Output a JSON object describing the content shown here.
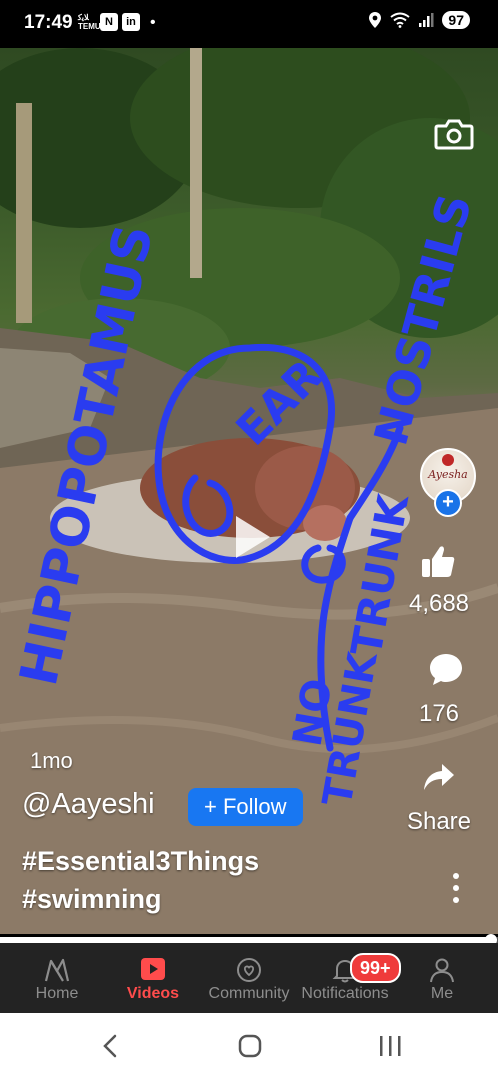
{
  "status_bar": {
    "time": "17:49",
    "temu_line1": "ﻼﻳﻛ",
    "temu_line2": "TEMU",
    "battery": "97",
    "icons": [
      "temu-icon",
      "n-app-icon",
      "linkedin-icon",
      "notification-dot",
      "location-icon",
      "wifi-icon",
      "signal-icon",
      "battery-icon"
    ]
  },
  "video": {
    "overlay_text": {
      "left_word": "HIPPOPOTAMUS",
      "center_word": "EAR",
      "right_word": "NOSTRILS",
      "bottom_word_1": "TRUNK",
      "bottom_word_2": "NO",
      "bottom_word_3": "TRUNK"
    },
    "paused": true
  },
  "author": {
    "avatar_text": "Ayesha",
    "handle": "@Aayeshi",
    "follow_label": "+ Follow"
  },
  "post": {
    "age": "1mo",
    "hashtags": [
      "#Essential3Things",
      "#swimning"
    ]
  },
  "actions": {
    "likes": "4,688",
    "comments": "176",
    "share_label": "Share"
  },
  "playback": {
    "progress_fraction": 0.985
  },
  "tabs": [
    {
      "label": "Home",
      "icon": "home-icon",
      "active": false
    },
    {
      "label": "Videos",
      "icon": "video-icon",
      "active": true
    },
    {
      "label": "Community",
      "icon": "community-icon",
      "active": false
    },
    {
      "label": "Notifications",
      "icon": "bell-icon",
      "active": false,
      "badge": "99+"
    },
    {
      "label": "Me",
      "icon": "profile-icon",
      "active": false
    }
  ],
  "colors": {
    "accent_blue": "#1877f2",
    "active_tab": "#ff4c4c",
    "badge_red": "#ef3b3b",
    "scribble_blue": "#2a3cf0"
  }
}
